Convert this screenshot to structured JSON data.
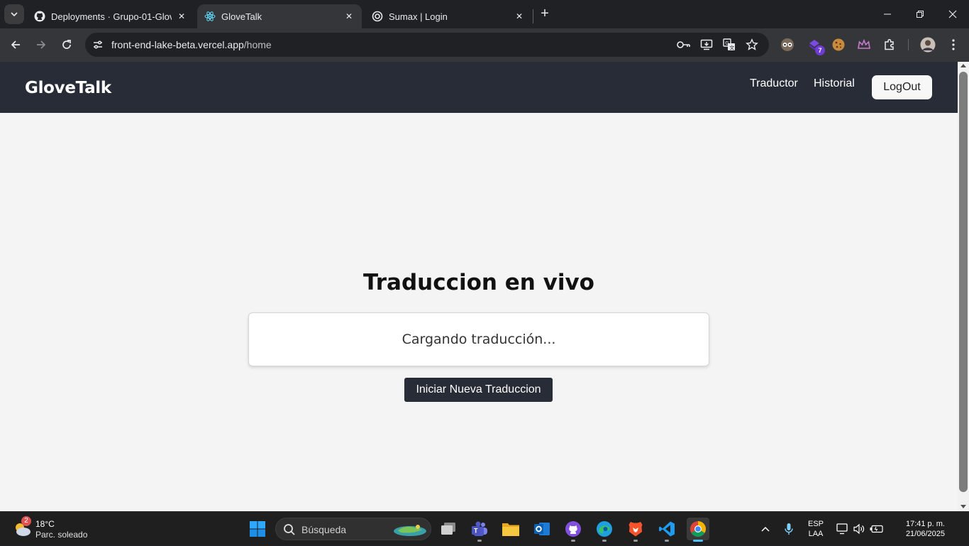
{
  "browser": {
    "tabs": [
      {
        "title": "Deployments · Grupo-01-Glove",
        "favicon": "github-icon",
        "active": false
      },
      {
        "title": "GloveTalk",
        "favicon": "react-icon",
        "active": true
      },
      {
        "title": "Sumax | Login",
        "favicon": "globe-icon",
        "active": false
      }
    ],
    "url_host": "front-end-lake-beta.vercel.app",
    "url_path": "/home",
    "extension_badge": "7"
  },
  "app": {
    "brand": "GloveTalk",
    "nav": {
      "traductor": "Traductor",
      "historial": "Historial",
      "logout": "LogOut"
    },
    "title": "Traduccion en vivo",
    "result_text": "Cargando traducción...",
    "primary_button": "Iniciar Nueva Traduccion",
    "colors": {
      "nav_bg": "#282c37",
      "page_bg": "#f4f4f4",
      "button_bg": "#282c37"
    }
  },
  "taskbar": {
    "weather": {
      "temp": "18°C",
      "desc": "Parc. soleado",
      "badge": "2"
    },
    "search_placeholder": "Búsqueda",
    "lang_line1": "ESP",
    "lang_line2": "LAA",
    "time": "17:41 p. m.",
    "date": "21/06/2025"
  }
}
